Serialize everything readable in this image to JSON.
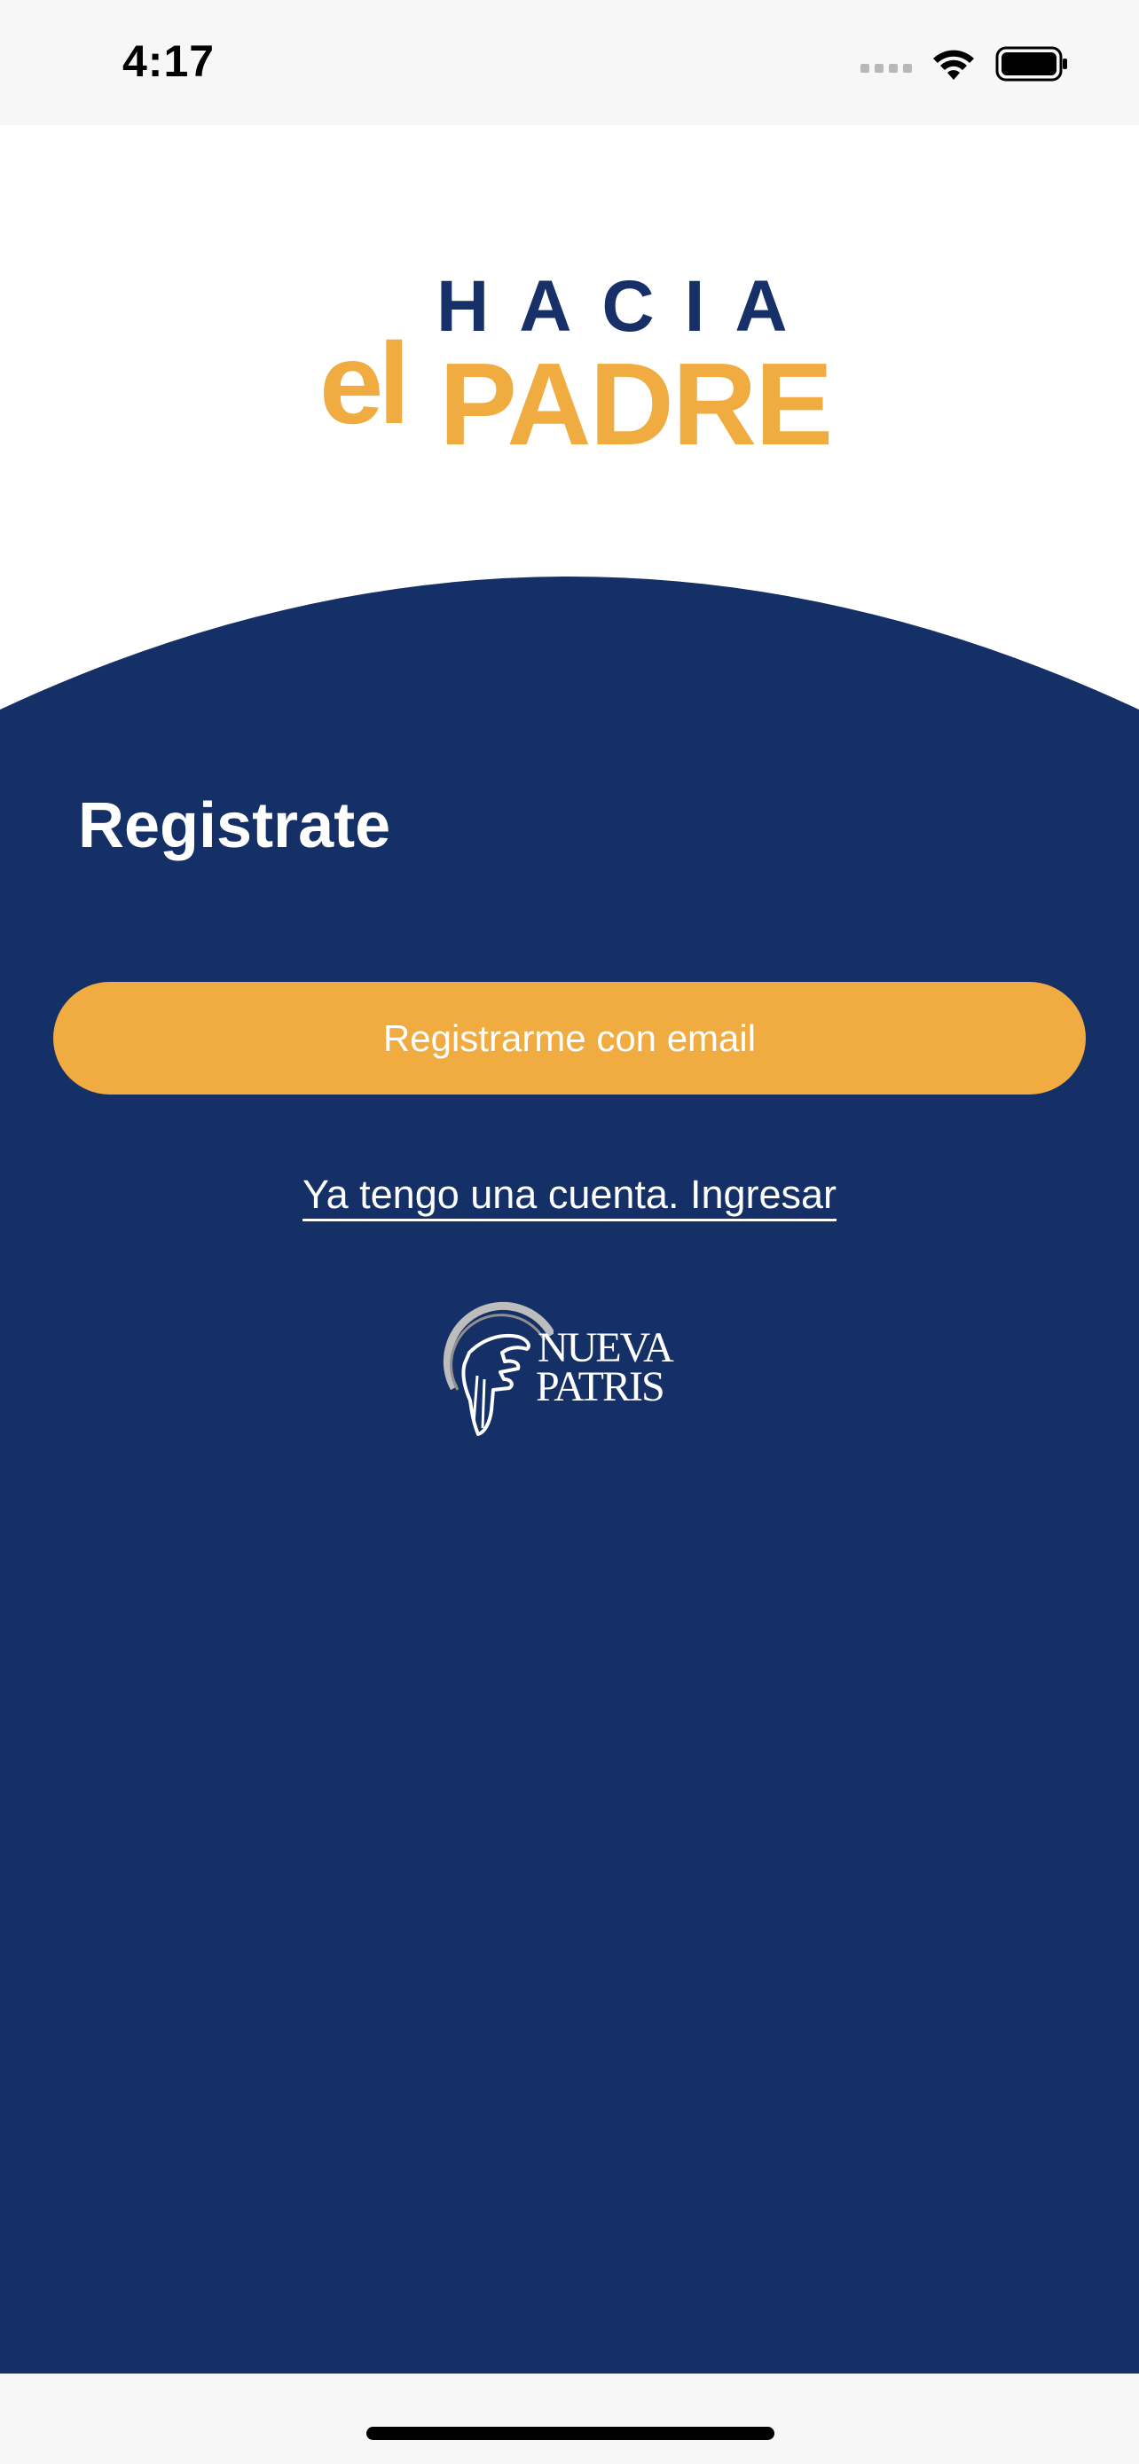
{
  "status_bar": {
    "time": "4:17"
  },
  "logo": {
    "line1": "HACIA",
    "line2_small": "el",
    "line2_large": "PADRE"
  },
  "panel": {
    "title": "Registrate",
    "email_button_label": "Registrarme con email",
    "login_link_label": "Ya tengo una cuenta. Ingresar"
  },
  "brand": {
    "line1": "NUEVA",
    "line2": "PATRIS"
  },
  "colors": {
    "navy": "#153067",
    "accent": "#f0ab41",
    "status_bar_bg": "#f7f7f7"
  },
  "icons": {
    "cellular": "cellular-signal-icon",
    "wifi": "wifi-icon",
    "battery": "battery-icon",
    "brand_emblem": "hand-emblem-icon"
  }
}
